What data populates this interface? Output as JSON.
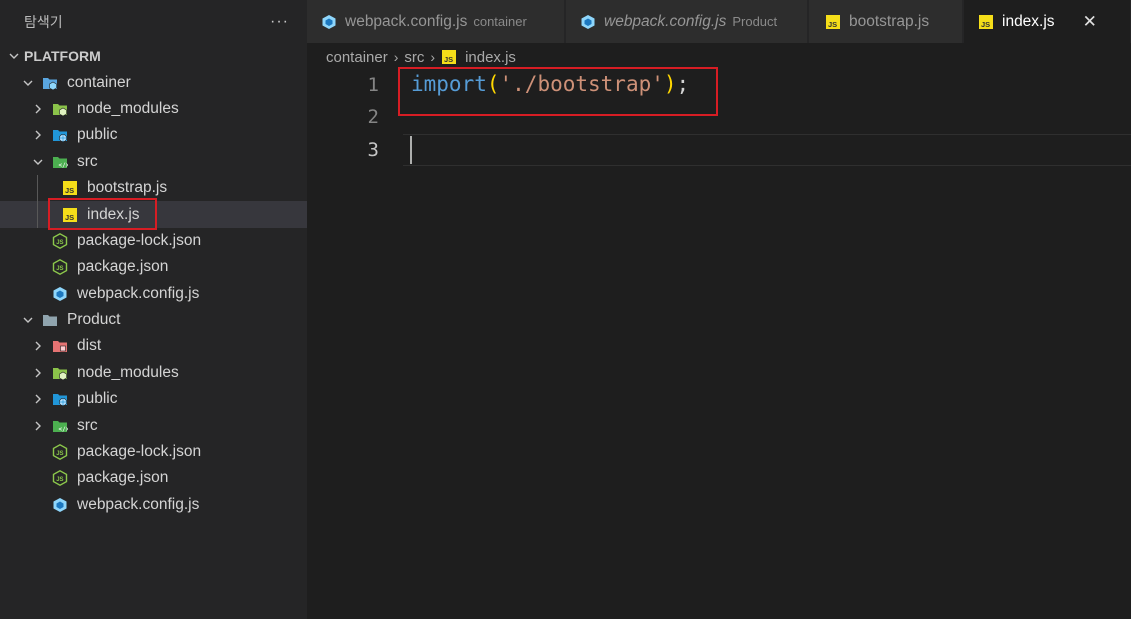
{
  "sidebar": {
    "title": "탐색기",
    "more": "···",
    "tree": [
      {
        "label": "PLATFORM",
        "type": "root",
        "chevron": "open"
      },
      {
        "label": "container",
        "type": "folder",
        "icon": "folder-webpack-open-icon",
        "chevron": "open"
      },
      {
        "label": "node_modules",
        "type": "folder",
        "icon": "folder-node-icon",
        "chevron": "closed"
      },
      {
        "label": "public",
        "type": "folder",
        "icon": "folder-public-icon",
        "chevron": "closed"
      },
      {
        "label": "src",
        "type": "folder",
        "icon": "folder-src-open-icon",
        "chevron": "open"
      },
      {
        "label": "bootstrap.js",
        "type": "file",
        "icon": "js-file-icon"
      },
      {
        "label": "index.js",
        "type": "file",
        "icon": "js-file-icon",
        "selected": true
      },
      {
        "label": "package-lock.json",
        "type": "file",
        "icon": "nodejs-file-icon"
      },
      {
        "label": "package.json",
        "type": "file",
        "icon": "nodejs-file-icon"
      },
      {
        "label": "webpack.config.js",
        "type": "file",
        "icon": "webpack-file-icon"
      },
      {
        "label": "Product",
        "type": "folder",
        "icon": "folder-open-icon",
        "chevron": "open"
      },
      {
        "label": "dist",
        "type": "folder",
        "icon": "folder-dist-icon",
        "chevron": "closed"
      },
      {
        "label": "node_modules",
        "type": "folder",
        "icon": "folder-node-icon",
        "chevron": "closed"
      },
      {
        "label": "public",
        "type": "folder",
        "icon": "folder-public-icon",
        "chevron": "closed"
      },
      {
        "label": "src",
        "type": "folder",
        "icon": "folder-src-icon",
        "chevron": "closed"
      },
      {
        "label": "package-lock.json",
        "type": "file",
        "icon": "nodejs-file-icon"
      },
      {
        "label": "package.json",
        "type": "file",
        "icon": "nodejs-file-icon"
      },
      {
        "label": "webpack.config.js",
        "type": "file",
        "icon": "webpack-file-icon"
      }
    ]
  },
  "tabs": [
    {
      "name": "webpack.config.js",
      "description": "container",
      "icon": "webpack-file-icon"
    },
    {
      "name": "webpack.config.js",
      "description": "Product",
      "icon": "webpack-file-icon",
      "italic": true
    },
    {
      "name": "bootstrap.js",
      "description": "",
      "icon": "js-file-icon"
    },
    {
      "name": "index.js",
      "description": "",
      "icon": "js-file-icon",
      "active": true,
      "close": "✕"
    }
  ],
  "breadcrumb": {
    "parts": [
      "container",
      "src",
      "index.js"
    ],
    "sep": "›"
  },
  "editor": {
    "line_numbers": [
      "1",
      "2",
      "3"
    ],
    "code": {
      "keyword": "import",
      "open_paren": "(",
      "string": "'./bootstrap'",
      "close_paren": ")",
      "semicolon": ";"
    }
  },
  "colors": {
    "highlight_box": "#d71d24",
    "keyword": "#569cd6",
    "string": "#ce9178",
    "paren": "#ffd700"
  }
}
